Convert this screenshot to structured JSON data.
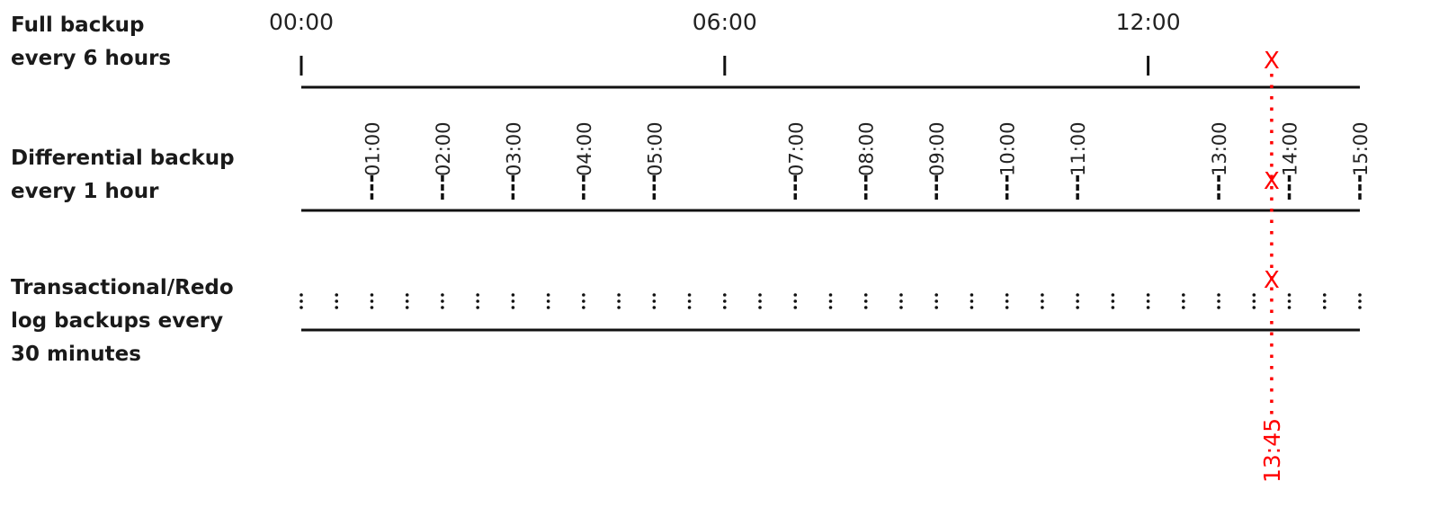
{
  "rows": [
    {
      "label": "Full backup\nevery 6 hours",
      "interval_minutes": 360,
      "tick_labels": [
        "00:00",
        "06:00",
        "12:00"
      ]
    },
    {
      "label": "Differential backup\nevery 1 hour",
      "interval_minutes": 60,
      "tick_labels": [
        "01:00",
        "02:00",
        "03:00",
        "04:00",
        "05:00",
        "07:00",
        "08:00",
        "09:00",
        "10:00",
        "11:00",
        "13:00",
        "14:00",
        "15:00"
      ]
    },
    {
      "label": "Transactional/Redo\nlog backups every\n30 minutes",
      "interval_minutes": 30
    }
  ],
  "timeline": {
    "start": "00:00",
    "end": "15:00"
  },
  "failure": {
    "time": "13:45",
    "marker": "X",
    "color": "#ff0000"
  }
}
